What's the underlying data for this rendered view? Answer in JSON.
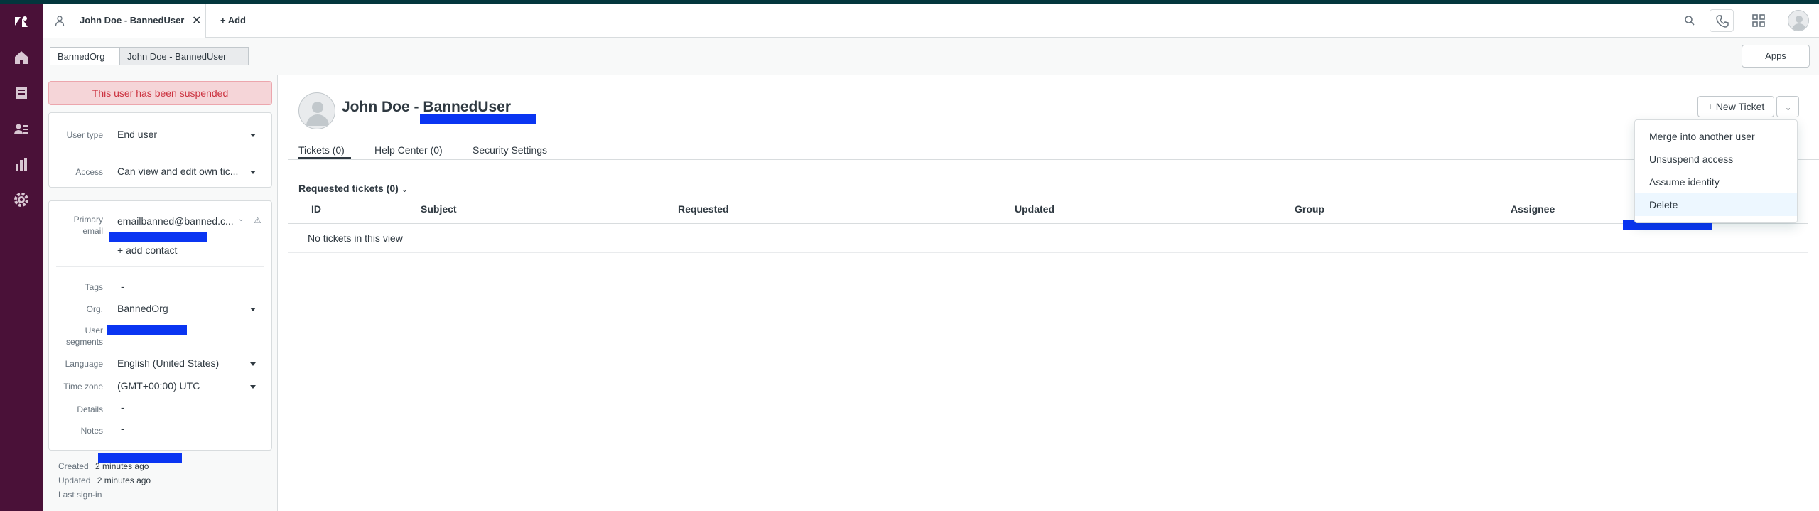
{
  "header": {
    "tab_title": "John Doe - BannedUser",
    "add_label": "+ Add"
  },
  "breadcrumb": {
    "org": "BannedOrg",
    "user": "John Doe - BannedUser"
  },
  "apps_label": "Apps",
  "sidebar": {
    "suspended_notice": "This user has been suspended",
    "fields": {
      "user_type_label": "User type",
      "user_type_value": "End user",
      "access_label": "Access",
      "access_value": "Can view and edit own tic...",
      "primary_email_label": "Primary email",
      "primary_email_value": "emailbanned@banned.c...",
      "add_contact": "+ add contact",
      "tags_label": "Tags",
      "tags_value": "-",
      "org_label": "Org.",
      "org_value": "BannedOrg",
      "segments_label": "User segments",
      "language_label": "Language",
      "language_value": "English (United States)",
      "timezone_label": "Time zone",
      "timezone_value": "(GMT+00:00) UTC",
      "details_label": "Details",
      "details_value": "-",
      "notes_label": "Notes",
      "notes_value": "-"
    },
    "meta": {
      "created_label": "Created",
      "created_value": "2 minutes ago",
      "updated_label": "Updated",
      "updated_value": "2 minutes ago",
      "last_signin_label": "Last sign-in"
    }
  },
  "main": {
    "user_name": "John Doe - BannedUser",
    "new_ticket_label": "+ New Ticket",
    "tabs": [
      {
        "label": "Tickets (0)"
      },
      {
        "label": "Help Center (0)"
      },
      {
        "label": "Security Settings"
      }
    ],
    "requested_title": "Requested tickets (0)",
    "columns": [
      "ID",
      "Subject",
      "Requested",
      "Updated",
      "Group",
      "Assignee"
    ],
    "empty_text": "No tickets in this view"
  },
  "menu": {
    "items": [
      {
        "label": "Merge into another user"
      },
      {
        "label": "Unsuspend access"
      },
      {
        "label": "Assume identity"
      },
      {
        "label": "Delete"
      }
    ]
  },
  "colors": {
    "nav_background": "#4a1138",
    "accent": "#1f73b7",
    "suspended_background": "#f5d5d8",
    "suspended_text": "#cc3340",
    "redaction": "#0a35f2"
  }
}
